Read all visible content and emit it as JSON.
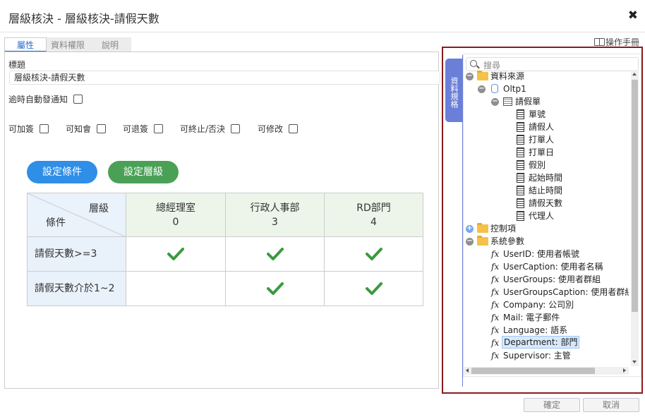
{
  "window": {
    "title": "層級核決 - 層級核決-請假天數"
  },
  "tabs": [
    {
      "label": "屬性",
      "active": true
    },
    {
      "label": "資料權限",
      "active": false
    },
    {
      "label": "說明",
      "active": false
    }
  ],
  "manual_label": "操作手冊",
  "form": {
    "title_label": "標題",
    "title_value": "層級核決-請假天數",
    "overdue_notify_label": "逾時自動發通知",
    "options": [
      {
        "label": "可加簽",
        "checked": false
      },
      {
        "label": "可知會",
        "checked": false
      },
      {
        "label": "可退簽",
        "checked": false
      },
      {
        "label": "可終止/否決",
        "checked": false
      },
      {
        "label": "可修改",
        "checked": false
      }
    ]
  },
  "buttons": {
    "set_condition": "設定條件",
    "set_level": "設定層級",
    "confirm": "確定",
    "cancel": "取消"
  },
  "matrix": {
    "corner_level": "層級",
    "corner_condition": "條件",
    "columns": [
      {
        "name": "總經理室",
        "level": "0"
      },
      {
        "name": "行政人事部",
        "level": "3"
      },
      {
        "name": "RD部門",
        "level": "4"
      }
    ],
    "rows": [
      {
        "condition": "請假天數>=3",
        "checks": [
          true,
          true,
          true
        ]
      },
      {
        "condition": "請假天數介於1~2",
        "checks": [
          false,
          true,
          true
        ]
      }
    ]
  },
  "side_tab_label": "資料規格",
  "search_placeholder": "搜尋",
  "tree": {
    "data_source": "資料來源",
    "oltp": "Oltp1",
    "table": "請假單",
    "fields": [
      "單號",
      "請假人",
      "打單人",
      "打單日",
      "假別",
      "起始時間",
      "結止時間",
      "請假天數",
      "代理人"
    ],
    "control": "控制項",
    "system_params": "系統參數",
    "params": [
      "UserID: 使用者帳號",
      "UserCaption: 使用者名稱",
      "UserGroups: 使用者群組",
      "UserGroupsCaption: 使用者群組",
      "Company: 公司別",
      "Mail: 電子郵件",
      "Language: 語系",
      "Department: 部門",
      "Supervisor: 主管"
    ],
    "selected_param": "Department: 部門"
  },
  "colors": {
    "accent_blue": "#2f8ee8",
    "accent_green": "#4aa156",
    "check_green": "#3a9a3f",
    "highlight_frame": "#8b1c1c",
    "side_tab": "#6b7fd8"
  }
}
